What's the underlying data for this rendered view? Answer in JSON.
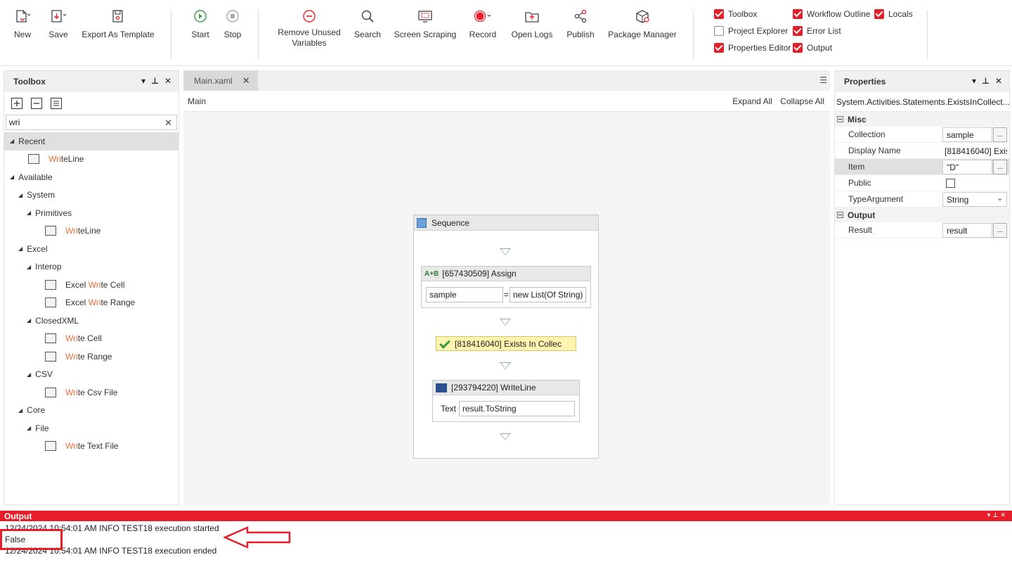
{
  "ribbon": {
    "new": "New",
    "save": "Save",
    "export_template": "Export As Template",
    "start": "Start",
    "stop": "Stop",
    "remove_unused_line1": "Remove Unused",
    "remove_unused_line2": "Variables",
    "search": "Search",
    "screen_scraping": "Screen Scraping",
    "record": "Record",
    "open_logs": "Open Logs",
    "publish": "Publish",
    "package_manager": "Package Manager",
    "checks": {
      "toolbox": "Toolbox",
      "project_explorer": "Project Explorer",
      "properties_editor": "Properties Editor",
      "workflow_outline": "Workflow Outline",
      "error_list": "Error List",
      "output": "Output",
      "locals": "Locals"
    },
    "check_states": {
      "toolbox": true,
      "project_explorer": false,
      "properties_editor": true,
      "workflow_outline": true,
      "error_list": true,
      "output": true,
      "locals": true
    }
  },
  "toolbox": {
    "title": "Toolbox",
    "search_value": "wri",
    "tree": {
      "recent": "Recent",
      "recent_item_hl": "Wri",
      "recent_item_rest": "teLine",
      "available": "Available",
      "system": "System",
      "primitives": "Primitives",
      "primitives_item_hl": "Wri",
      "primitives_item_rest": "teLine",
      "excel": "Excel",
      "interop": "Interop",
      "excel_write_cell_pre": "Excel ",
      "excel_write_cell_hl": "Wri",
      "excel_write_cell_rest": "te Cell",
      "excel_write_range_pre": "Excel ",
      "excel_write_range_hl": "Wri",
      "excel_write_range_rest": "te Range",
      "closedxml": "ClosedXML",
      "write_cell_hl": "Wri",
      "write_cell_rest": "te Cell",
      "write_range_hl": "Wri",
      "write_range_rest": "te Range",
      "csv": "CSV",
      "write_csv_hl": "Wri",
      "write_csv_rest": "te Csv File",
      "core": "Core",
      "file": "File",
      "write_text_hl": "Wri",
      "write_text_rest": "te Text File"
    }
  },
  "designer": {
    "tab": "Main.xaml",
    "breadcrumb": "Main",
    "expand_all": "Expand All",
    "collapse_all": "Collapse All",
    "sequence_title": "Sequence",
    "assign_title": "[657430509] Assign",
    "assign_left": "sample",
    "assign_eq": "=",
    "assign_right": "new List(Of String)",
    "exists_title": "[818416040] Exists In Collec",
    "writeline_title": "[293794220] WriteLine",
    "writeline_text_label": "Text",
    "writeline_text_value": "result.ToString"
  },
  "properties": {
    "title": "Properties",
    "type_name": "System.Activities.Statements.ExistsInCollect...",
    "misc": "Misc",
    "collection_label": "Collection",
    "collection_value": "sample",
    "display_name_label": "Display Name",
    "display_name_value": "[818416040] Exis",
    "item_label": "Item",
    "item_value": "\"D\"",
    "public_label": "Public",
    "type_argument_label": "TypeArgument",
    "type_argument_value": "String",
    "output": "Output",
    "result_label": "Result",
    "result_value": "result",
    "dots": "..."
  },
  "output": {
    "title": "Output",
    "lines": [
      "12/24/2024 10:54:01 AM INFO TEST18 execution started",
      "False",
      "12/24/2024 10:54:01 AM INFO TEST18 execution ended"
    ]
  },
  "colors": {
    "accent_red": "#e81d2a",
    "highlight_orange": "#e8703a",
    "exists_fill": "#fff3b0"
  }
}
